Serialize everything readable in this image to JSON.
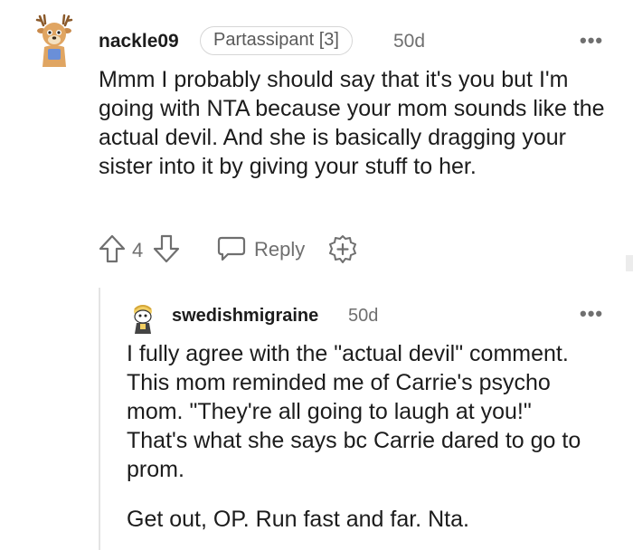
{
  "comment": {
    "username": "nackle09",
    "flair": "Partassipant [3]",
    "age": "50d",
    "more_label": "•••",
    "text": "Mmm I probably should say that it's you but I'm going with NTA because your mom sounds like the actual devil. And she is basically dragging your sister into it by giving your stuff to her.",
    "vote_count": "4",
    "reply_label": "Reply",
    "icons": {
      "upvote": "arrow-up-icon",
      "downvote": "arrow-down-icon",
      "reply": "chat-bubble-icon",
      "award": "plus-circle-icon"
    }
  },
  "reply": {
    "username": "swedishmigraine",
    "age": "50d",
    "more_label": "•••",
    "paragraphs": [
      "I fully agree with the \"actual devil\" comment. This mom reminded me of Carrie's psycho mom. \"They're all going to laugh at you!\" That's what she says bc Carrie dared to go to prom.",
      "Get out, OP. Run fast and far. Nta."
    ]
  },
  "colors": {
    "text": "#1c1c1c",
    "muted": "#6f6f6f",
    "flair_border": "#d6d6d6",
    "thread_line": "#e4e4e4"
  }
}
